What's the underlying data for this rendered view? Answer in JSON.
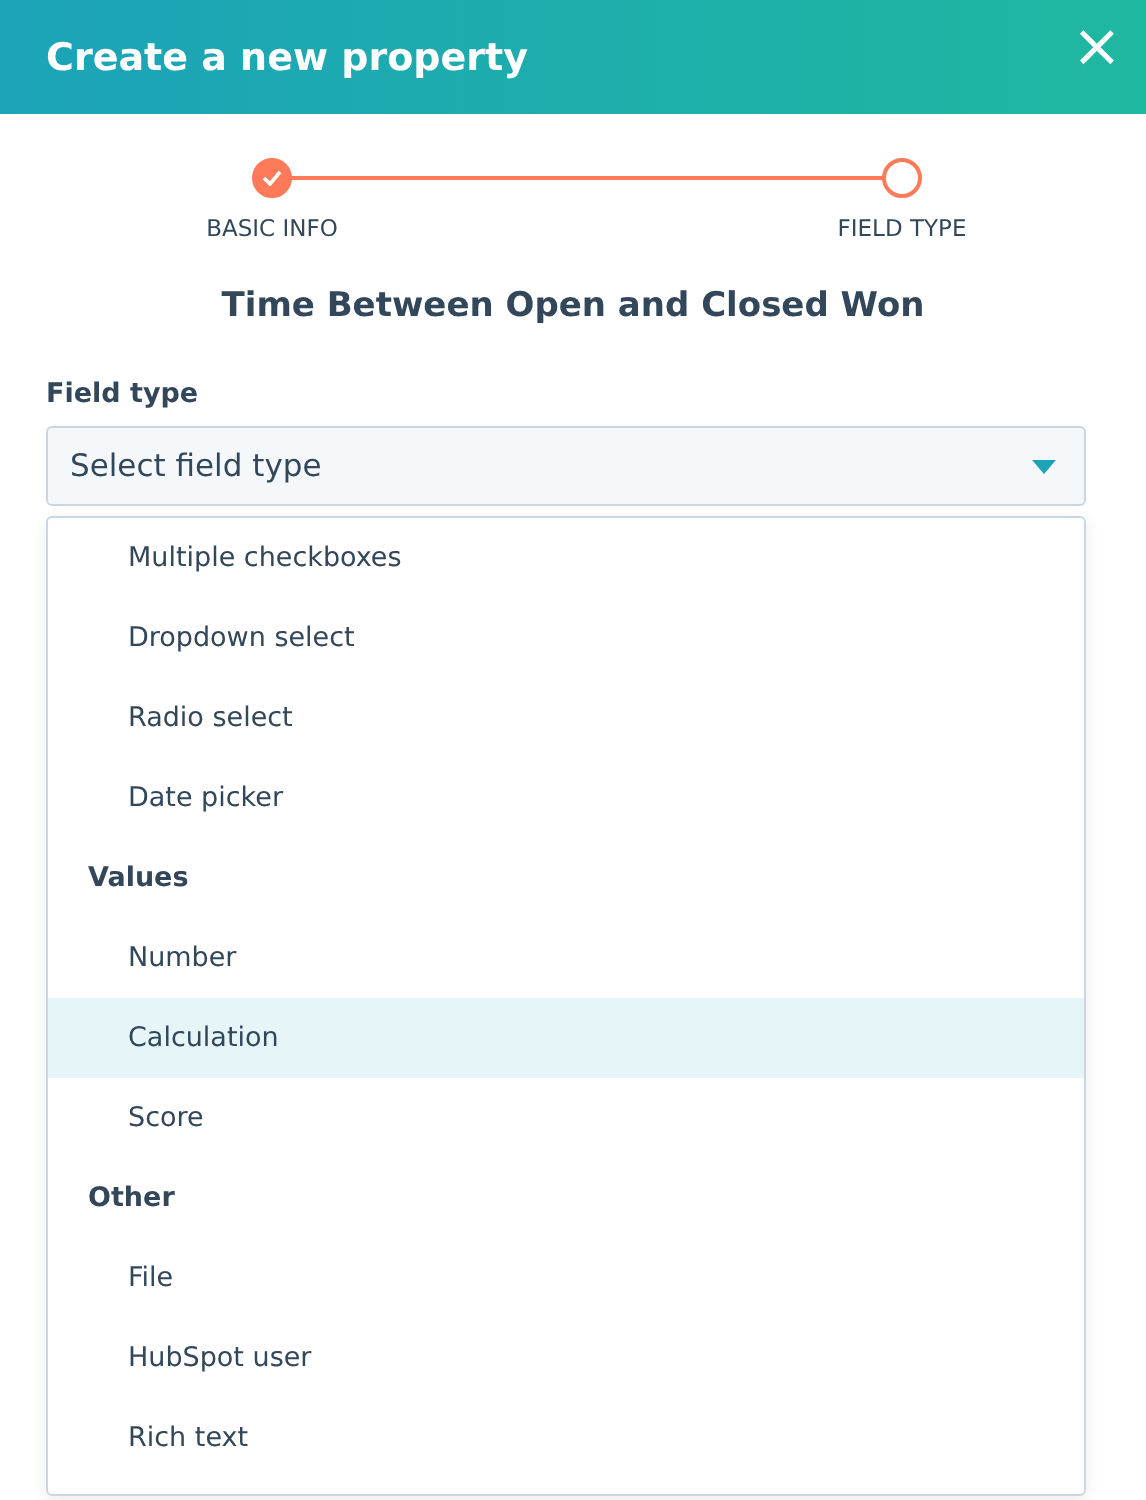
{
  "dialog": {
    "title": "Create a new property",
    "close_icon": "×"
  },
  "steps": [
    {
      "label": "BASIC INFO",
      "done": true
    },
    {
      "label": "FIELD TYPE",
      "done": false
    }
  ],
  "heading": "Time Between Open and Closed Won",
  "field": {
    "label": "Field type",
    "placeholder": "Select field type",
    "expanded": true
  },
  "menu": [
    {
      "options": [
        {
          "label": "Multiple checkboxes",
          "selected": false
        },
        {
          "label": "Dropdown select",
          "selected": false
        },
        {
          "label": "Radio select",
          "selected": false
        },
        {
          "label": "Date picker",
          "selected": false
        }
      ]
    },
    {
      "heading": "Values",
      "options": [
        {
          "label": "Number",
          "selected": false
        },
        {
          "label": "Calculation",
          "selected": true
        },
        {
          "label": "Score",
          "selected": false
        }
      ]
    },
    {
      "heading": "Other",
      "options": [
        {
          "label": "File",
          "selected": false
        },
        {
          "label": "HubSpot user",
          "selected": false
        },
        {
          "label": "Rich text",
          "selected": false
        }
      ]
    }
  ]
}
